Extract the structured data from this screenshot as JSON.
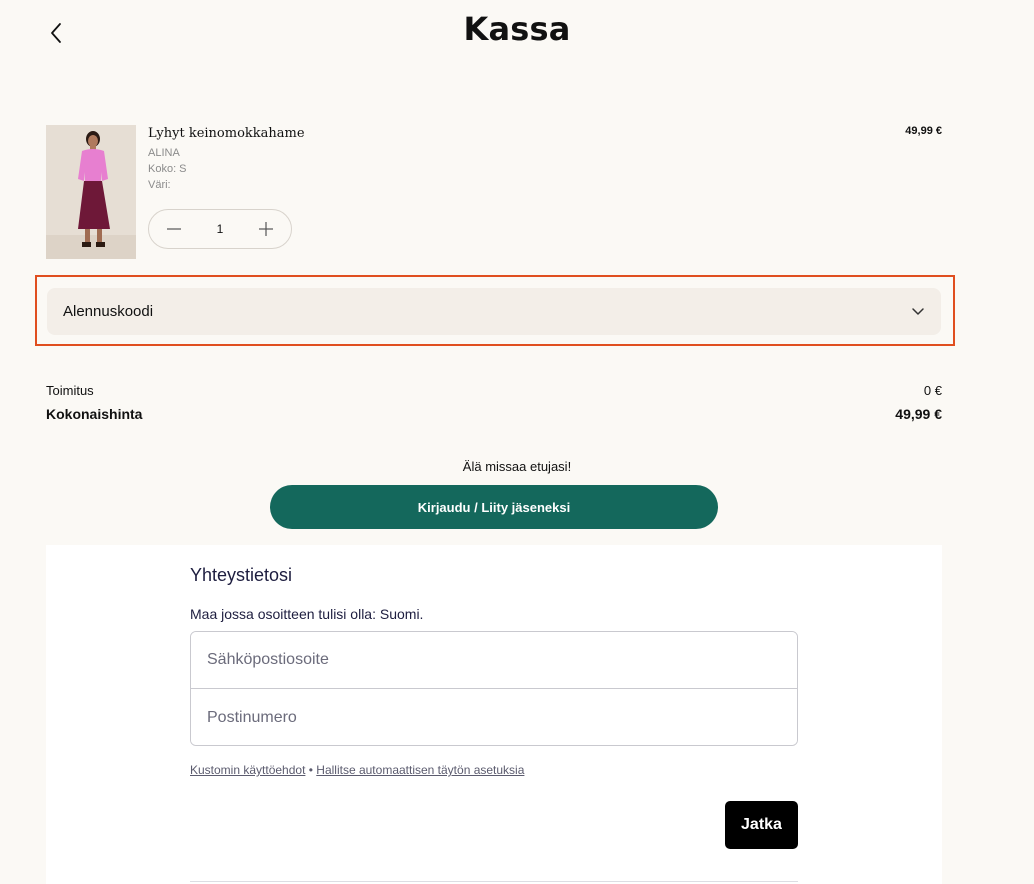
{
  "header": {
    "title": "Kassa",
    "back_icon": "chevron-left-icon"
  },
  "cart": {
    "item": {
      "name": "Lyhyt keinomokkahame",
      "brand": "ALINA",
      "size": "Koko: S",
      "color": "Väri:",
      "quantity": "1",
      "price": "49,99 €",
      "image": "product-photo"
    }
  },
  "discount": {
    "label": "Alennuskoodi",
    "highlight_color": "#e04e1f"
  },
  "summary": {
    "shipping_label": "Toimitus",
    "shipping_value": "0 €",
    "total_label": "Kokonaishinta",
    "total_value": "49,99 €"
  },
  "promo": {
    "text": "Älä missaa etujasi!",
    "login_label": "Kirjaudu / Liity jäseneksi",
    "accent_color": "#14685c"
  },
  "contact": {
    "title": "Yhteystietosi",
    "country_note": "Maa jossa osoitteen tulisi olla: Suomi.",
    "email_placeholder": "Sähköpostiosoite",
    "zip_placeholder": "Postinumero",
    "terms_link": "Kustomin käyttöehdot",
    "separator": " • ",
    "autofill_link": "Hallitse automaattisen täytön asetuksia",
    "continue_label": "Jatka"
  }
}
